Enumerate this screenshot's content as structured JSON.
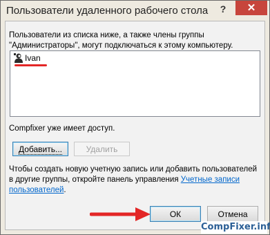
{
  "window": {
    "title": "Пользователи удаленного рабочего стола",
    "help_label": "?",
    "close_label": "✕"
  },
  "description": "Пользователи из списка ниже, а также члены группы \"Администраторы\", могут подключаться к этому компьютеру.",
  "users": [
    {
      "name": "Ivan",
      "icon": "user-icon"
    }
  ],
  "access_text": "Compfixer уже имеет доступ.",
  "buttons": {
    "add_label": "Добавить...",
    "remove_label": "Удалить",
    "ok_label": "ОК",
    "cancel_label": "Отмена"
  },
  "bottom_text_before_link": "Чтобы создать новую учетную запись или добавить пользователей в другие группы, откройте панель управления ",
  "bottom_link": "Учетные записи пользователей",
  "bottom_text_after_link": ".",
  "watermark": "CompFixer.info",
  "colors": {
    "close_button": "#c7453c",
    "annotation_red": "#e32626",
    "link": "#0066cc"
  }
}
